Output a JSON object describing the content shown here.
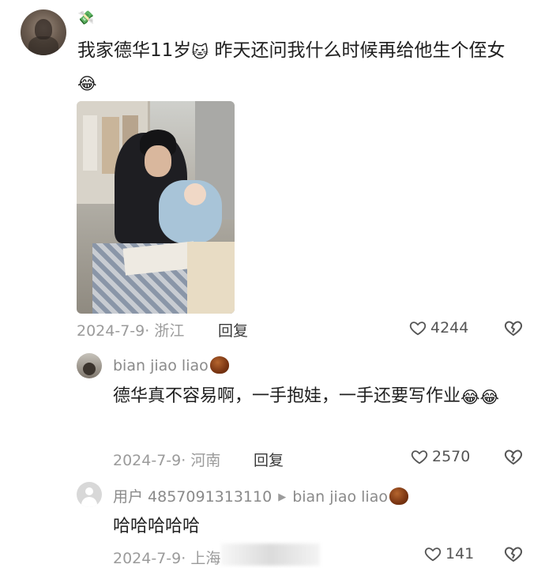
{
  "post": {
    "badge_emoji": "💸",
    "text_part1": "我家德华11岁",
    "emoji_mid": "🐱",
    "text_part2": " 昨天还问我什么时候再给他生个侄女",
    "emoji_end": "😂",
    "date": "2024-7-9",
    "location": "· 浙江",
    "reply_label": "回复",
    "likes": "4244"
  },
  "comments": [
    {
      "username": "bian jiao liao",
      "text": "德华真不容易啊，一手抱娃，一手还要写作业",
      "emoji_end": "😂😂",
      "date": "2024-7-9",
      "location": "· 河南",
      "reply_label": "回复",
      "likes": "2570"
    },
    {
      "username": "用户 4857091313110",
      "reply_to": "bian jiao liao",
      "text": "哈哈哈哈哈",
      "date": "2024-7-9",
      "location": "· 上海",
      "likes": "141"
    }
  ],
  "colors": {
    "meta_gray": "#9b9b9b",
    "text_dark": "#1f1f1f",
    "heart_stroke": "#555555"
  },
  "icons": {
    "like": "heart-outline-icon",
    "dislike": "broken-heart-icon",
    "reply_arrow": "triangle-right-icon"
  }
}
